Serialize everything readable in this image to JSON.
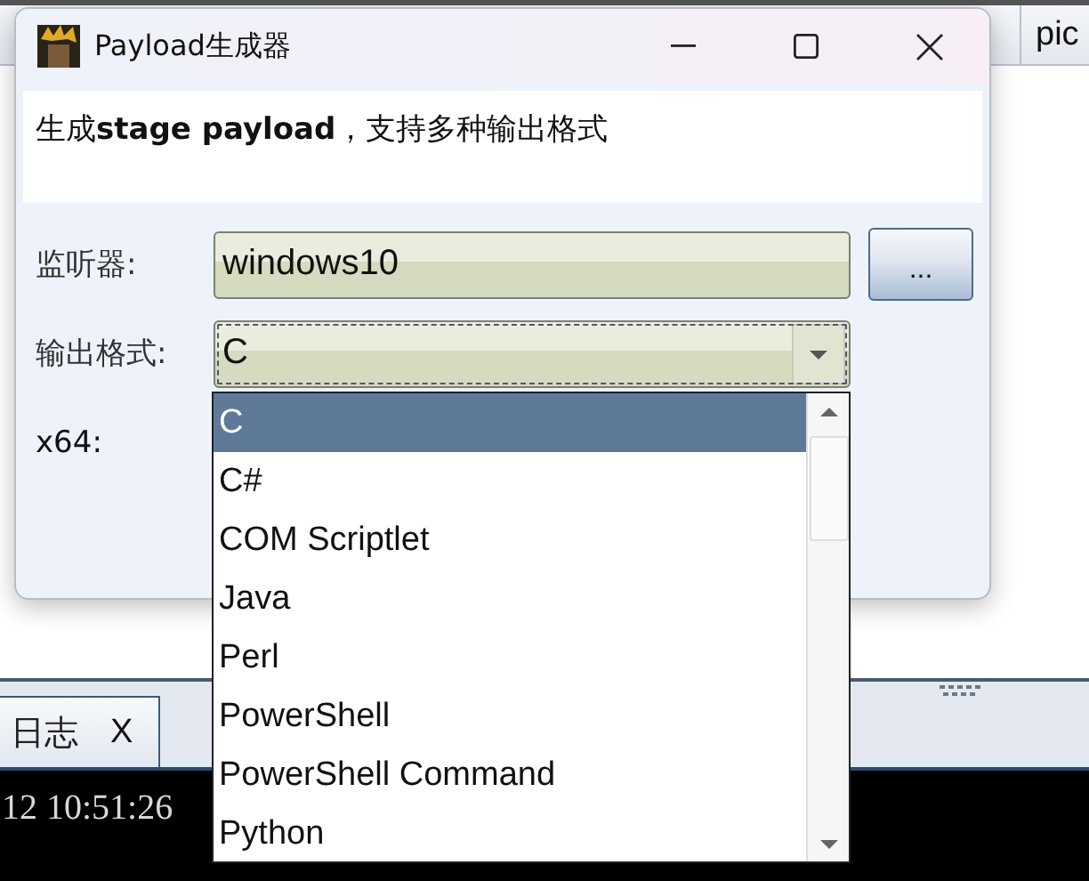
{
  "background_app": {
    "column_header": "pic",
    "log_tab": {
      "label": "日志",
      "close": "X"
    },
    "console_line": "12 10:51:26"
  },
  "dialog": {
    "title": "Payload生成器",
    "description": "生成**stage payload**，支持多种输出格式",
    "fields": [
      {
        "kind": "text",
        "label": "监听器:",
        "value": "windows10",
        "button": "..."
      },
      {
        "kind": "combo",
        "label": "输出格式:",
        "value": "C",
        "open": true
      }
    ],
    "x64_label": "x64:"
  },
  "dropdown": {
    "options": [
      {
        "label": "C",
        "selected": true
      },
      {
        "label": "C#",
        "selected": false
      },
      {
        "label": "COM Scriptlet",
        "selected": false
      },
      {
        "label": "Java",
        "selected": false
      },
      {
        "label": "Perl",
        "selected": false
      },
      {
        "label": "PowerShell",
        "selected": false
      },
      {
        "label": "PowerShell Command",
        "selected": false
      },
      {
        "label": "Python",
        "selected": false
      }
    ]
  }
}
